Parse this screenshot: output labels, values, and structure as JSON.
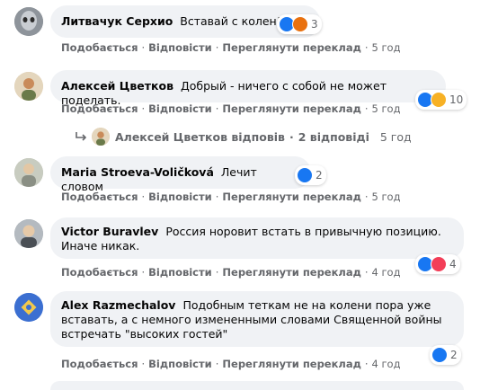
{
  "comments": [
    {
      "author": "Литвачук Серхио",
      "text": "Вставай с колен!",
      "reaction_count": "3",
      "reactions": [
        "like-icon",
        "angry-icon"
      ],
      "actions": {
        "like": "Подобається",
        "reply": "Відповісти",
        "translate": "Переглянути переклад",
        "time": "5 год"
      }
    },
    {
      "author": "Алексей Цветков",
      "text": "Добрый - ничего с собой не может поделать.",
      "reaction_count": "10",
      "reactions": [
        "like-icon",
        "haha-icon"
      ],
      "actions": {
        "like": "Подобається",
        "reply": "Відповісти",
        "translate": "Переглянути переклад",
        "time": "5 год"
      },
      "replies_summary": {
        "author": "Алексей Цветков відповів",
        "count": "2 відповіді",
        "time": "5 год"
      }
    },
    {
      "author": "Maria Stroeva-Voličková",
      "text": "Лечит словом",
      "reaction_count": "2",
      "reactions": [
        "like-icon"
      ],
      "actions": {
        "like": "Подобається",
        "reply": "Відповісти",
        "translate": "Переглянути переклад",
        "time": "5 год"
      }
    },
    {
      "author": "Victor Buravlev",
      "text": "Россия норовит встать в привычную позицию. Иначе никак.",
      "reaction_count": "4",
      "reactions": [
        "like-icon",
        "love-icon"
      ],
      "actions": {
        "like": "Подобається",
        "reply": "Відповісти",
        "translate": "Переглянути переклад",
        "time": "4 год"
      }
    },
    {
      "author": "Alex Razmechalov",
      "text": "Подобным теткам не на колени пора уже вставать, а с немного измененными словами Священной войны встречать \"высоких гостей\"",
      "reaction_count": "2",
      "reactions": [
        "like-icon"
      ],
      "actions": {
        "like": "Подобається",
        "reply": "Відповісти",
        "translate": "Переглянути переклад",
        "time": "4 год"
      }
    }
  ],
  "colors": {
    "bubble": "#f0f2f5",
    "meta": "#65676b",
    "like": "#1877f2",
    "love": "#f33e58",
    "haha": "#f7b125",
    "angry": "#e9710f"
  }
}
